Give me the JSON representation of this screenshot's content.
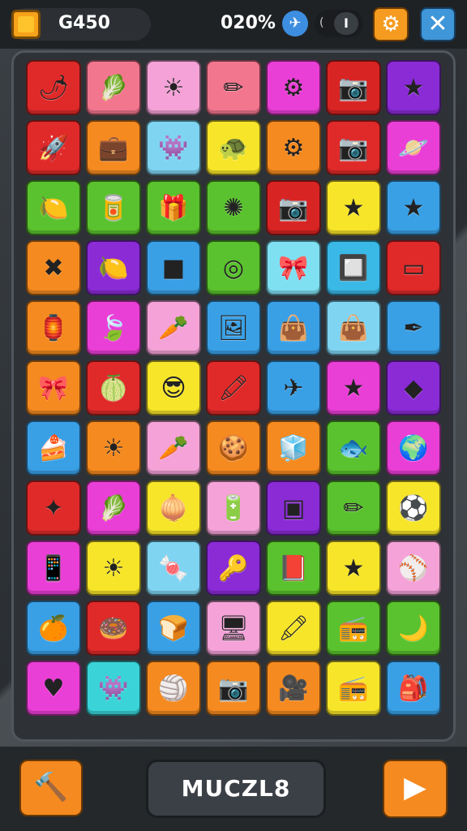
{
  "header": {
    "coin_icon": "coin-icon",
    "coins": "G450",
    "progress_text": "020%",
    "star_icon": "star-badge-icon",
    "toggle_icon": "toggle-icon",
    "settings_icon": "gear-icon",
    "close_icon": "close-icon"
  },
  "board": {
    "rows": [
      [
        {
          "color": "#e02a2a",
          "icon": "pepper-icon",
          "glyph": "🌶"
        },
        {
          "color": "#f2768e",
          "icon": "cabbage-icon",
          "glyph": "🥬"
        },
        {
          "color": "#f4a2d8",
          "icon": "sun-icon",
          "glyph": "☀"
        },
        {
          "color": "#f2768e",
          "icon": "pencil-icon",
          "glyph": "✏"
        },
        {
          "color": "#ea3fd6",
          "icon": "gear-icon",
          "glyph": "⚙"
        },
        {
          "color": "#d92424",
          "icon": "camera-icon",
          "glyph": "📷"
        },
        {
          "color": "#8a2bd6",
          "icon": "star-icon",
          "glyph": "★"
        }
      ],
      [
        {
          "color": "#e02a2a",
          "icon": "rocket-icon",
          "glyph": "🚀"
        },
        {
          "color": "#f58a20",
          "icon": "briefcase-icon",
          "glyph": "💼"
        },
        {
          "color": "#7fd4f2",
          "icon": "blob-icon",
          "glyph": "👾"
        },
        {
          "color": "#f7e52a",
          "icon": "turtle-icon",
          "glyph": "🐢"
        },
        {
          "color": "#f58a20",
          "icon": "gear-icon",
          "glyph": "⚙"
        },
        {
          "color": "#e02a2a",
          "icon": "camera-icon",
          "glyph": "📷"
        },
        {
          "color": "#ea3fd6",
          "icon": "planet-icon",
          "glyph": "🪐"
        }
      ],
      [
        {
          "color": "#5ac22e",
          "icon": "lemon-icon",
          "glyph": "🍋"
        },
        {
          "color": "#5ac22e",
          "icon": "can-icon",
          "glyph": "🥫"
        },
        {
          "color": "#5ac22e",
          "icon": "gift-icon",
          "glyph": "🎁"
        },
        {
          "color": "#5ac22e",
          "icon": "burst-icon",
          "glyph": "✺"
        },
        {
          "color": "#d92424",
          "icon": "camera-icon",
          "glyph": "📷"
        },
        {
          "color": "#f7e52a",
          "icon": "star-icon",
          "glyph": "★"
        },
        {
          "color": "#3aa0e6",
          "icon": "star-icon",
          "glyph": "★"
        }
      ],
      [
        {
          "color": "#f58a20",
          "icon": "crossed-sticks-icon",
          "glyph": "✖"
        },
        {
          "color": "#8a2bd6",
          "icon": "lemon-icon",
          "glyph": "🍋"
        },
        {
          "color": "#3aa0e6",
          "icon": "square-icon",
          "glyph": "■"
        },
        {
          "color": "#5ac22e",
          "icon": "donut-icon",
          "glyph": "◎"
        },
        {
          "color": "#7fe0f2",
          "icon": "bow-icon",
          "glyph": "🎀"
        },
        {
          "color": "#3ab8e6",
          "icon": "washer-icon",
          "glyph": "🔲"
        },
        {
          "color": "#e02a2a",
          "icon": "box-icon",
          "glyph": "▭"
        }
      ],
      [
        {
          "color": "#f58a20",
          "icon": "lantern-icon",
          "glyph": "🏮"
        },
        {
          "color": "#ea3fd6",
          "icon": "leaf-icon",
          "glyph": "🍃"
        },
        {
          "color": "#f4a2d8",
          "icon": "carrot-icon",
          "glyph": "🥕"
        },
        {
          "color": "#3aa0e6",
          "icon": "picture-icon",
          "glyph": "🖼"
        },
        {
          "color": "#3aa0e6",
          "icon": "bag-icon",
          "glyph": "👜"
        },
        {
          "color": "#7fd4f2",
          "icon": "bag-icon",
          "glyph": "👜"
        },
        {
          "color": "#3aa0e6",
          "icon": "pen-icon",
          "glyph": "✒"
        }
      ],
      [
        {
          "color": "#f58a20",
          "icon": "bow-icon",
          "glyph": "🎀"
        },
        {
          "color": "#e02a2a",
          "icon": "melon-icon",
          "glyph": "🍈"
        },
        {
          "color": "#f7e52a",
          "icon": "face-icon",
          "glyph": "😎"
        },
        {
          "color": "#e02a2a",
          "icon": "marker-icon",
          "glyph": "🖍"
        },
        {
          "color": "#3aa0e6",
          "icon": "plane-icon",
          "glyph": "✈"
        },
        {
          "color": "#ea3fd6",
          "icon": "star-icon",
          "glyph": "★"
        },
        {
          "color": "#8a2bd6",
          "icon": "gem-icon",
          "glyph": "◆"
        }
      ],
      [
        {
          "color": "#3aa0e6",
          "icon": "cake-icon",
          "glyph": "🍰"
        },
        {
          "color": "#f58a20",
          "icon": "sun-icon",
          "glyph": "☀"
        },
        {
          "color": "#f4a2d8",
          "icon": "carrot-icon",
          "glyph": "🥕"
        },
        {
          "color": "#f58a20",
          "icon": "cookie-icon",
          "glyph": "🍪"
        },
        {
          "color": "#f58a20",
          "icon": "cube-icon",
          "glyph": "🧊"
        },
        {
          "color": "#5ac22e",
          "icon": "fish-icon",
          "glyph": "🐟"
        },
        {
          "color": "#ea3fd6",
          "icon": "globe-icon",
          "glyph": "🌍"
        }
      ],
      [
        {
          "color": "#e02a2a",
          "icon": "sparkle-icon",
          "glyph": "✦"
        },
        {
          "color": "#ea3fd6",
          "icon": "cabbage-icon",
          "glyph": "🥬"
        },
        {
          "color": "#f7e52a",
          "icon": "turnip-icon",
          "glyph": "🧅"
        },
        {
          "color": "#f4a2d8",
          "icon": "battery-icon",
          "glyph": "🔋"
        },
        {
          "color": "#8a2bd6",
          "icon": "tablet-icon",
          "glyph": "▣"
        },
        {
          "color": "#5ac22e",
          "icon": "pencil-icon",
          "glyph": "✏"
        },
        {
          "color": "#f7e52a",
          "icon": "ball-icon",
          "glyph": "⚽"
        }
      ],
      [
        {
          "color": "#ea3fd6",
          "icon": "phone-icon",
          "glyph": "📱"
        },
        {
          "color": "#f7e52a",
          "icon": "sun-icon",
          "glyph": "☀"
        },
        {
          "color": "#7fd4f2",
          "icon": "candy-icon",
          "glyph": "🍬"
        },
        {
          "color": "#8a2bd6",
          "icon": "key-icon",
          "glyph": "🔑"
        },
        {
          "color": "#5ac22e",
          "icon": "book-icon",
          "glyph": "📕"
        },
        {
          "color": "#f7e52a",
          "icon": "star-icon",
          "glyph": "★"
        },
        {
          "color": "#f4a2d8",
          "icon": "ball-icon",
          "glyph": "⚾"
        }
      ],
      [
        {
          "color": "#3aa0e6",
          "icon": "fruit-icon",
          "glyph": "🍊"
        },
        {
          "color": "#e02a2a",
          "icon": "donut-icon",
          "glyph": "🍩"
        },
        {
          "color": "#3aa0e6",
          "icon": "bread-icon",
          "glyph": "🍞"
        },
        {
          "color": "#f4a2d8",
          "icon": "screen-icon",
          "glyph": "🖥"
        },
        {
          "color": "#f7e52a",
          "icon": "marker-icon",
          "glyph": "🖍"
        },
        {
          "color": "#5ac22e",
          "icon": "radio-icon",
          "glyph": "📻"
        },
        {
          "color": "#5ac22e",
          "icon": "moon-icon",
          "glyph": "🌙"
        }
      ],
      [
        {
          "color": "#ea3fd6",
          "icon": "heart-icon",
          "glyph": "♥"
        },
        {
          "color": "#3ad4d8",
          "icon": "blob-icon",
          "glyph": "👾"
        },
        {
          "color": "#f58a20",
          "icon": "ball-icon",
          "glyph": "🏐"
        },
        {
          "color": "#f58a20",
          "icon": "camera-icon",
          "glyph": "📷"
        },
        {
          "color": "#f58a20",
          "icon": "projector-icon",
          "glyph": "🎥"
        },
        {
          "color": "#f7e52a",
          "icon": "radio-icon",
          "glyph": "📻"
        },
        {
          "color": "#3aa0e6",
          "icon": "bag-icon",
          "glyph": "🎒"
        }
      ]
    ]
  },
  "footer": {
    "tool_icon": "hammer-icon",
    "title": "MUCZL8",
    "play_icon": "play-icon"
  }
}
